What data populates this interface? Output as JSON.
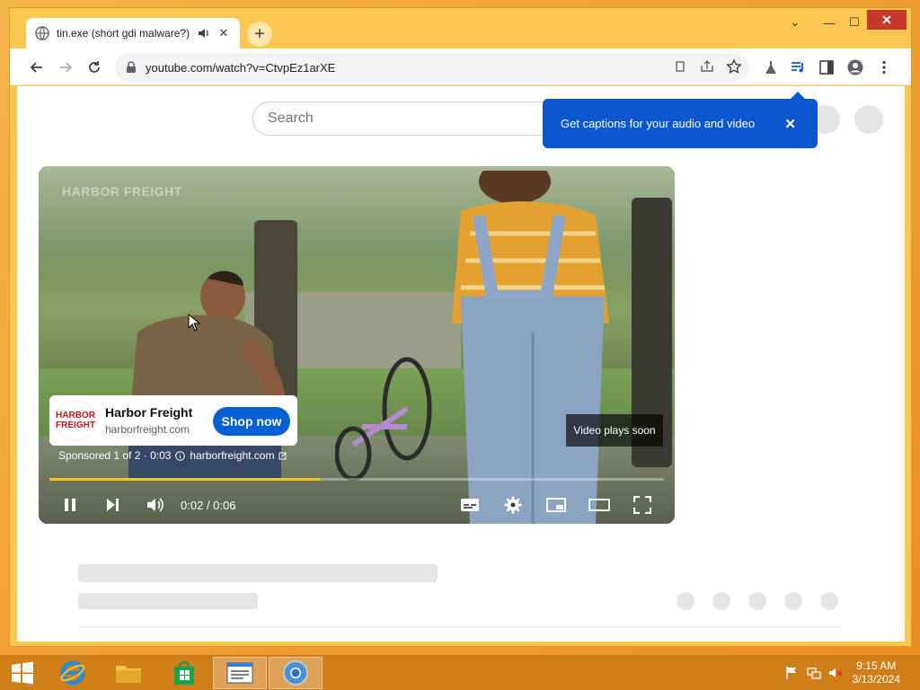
{
  "tab": {
    "title": "tin.exe (short gdi malware?)",
    "close_label": "✕",
    "new_tab_label": "+"
  },
  "window": {
    "chevron": "⌄",
    "min": "—",
    "max": "☐",
    "close": "✕"
  },
  "address": {
    "url": "youtube.com/watch?v=CtvpEz1arXE"
  },
  "page": {
    "search_placeholder": "Search",
    "tooltip": {
      "text": "Get captions for your audio and video",
      "close": "✕"
    }
  },
  "video": {
    "watermark": "HARBOR FREIGHT",
    "ad": {
      "logo_line1": "HARBOR",
      "logo_line2": "FREIGHT",
      "title": "Harbor Freight",
      "url": "harborfreight.com",
      "cta": "Shop now",
      "sponsored": "Sponsored 1 of 2 · 0:03",
      "sponsored_link": "harborfreight.com"
    },
    "plays_soon": "Video plays soon",
    "timecode": "0:02 / 0:06",
    "progress_fraction": 0.44
  },
  "taskbar": {
    "time": "9:15 AM",
    "date": "3/13/2024"
  },
  "colors": {
    "accent_blue": "#0b57d0",
    "cta_blue": "#065fd4",
    "progress": "#f5c518",
    "window_frame": "#fbc74e",
    "taskbar": "#d07e18"
  }
}
